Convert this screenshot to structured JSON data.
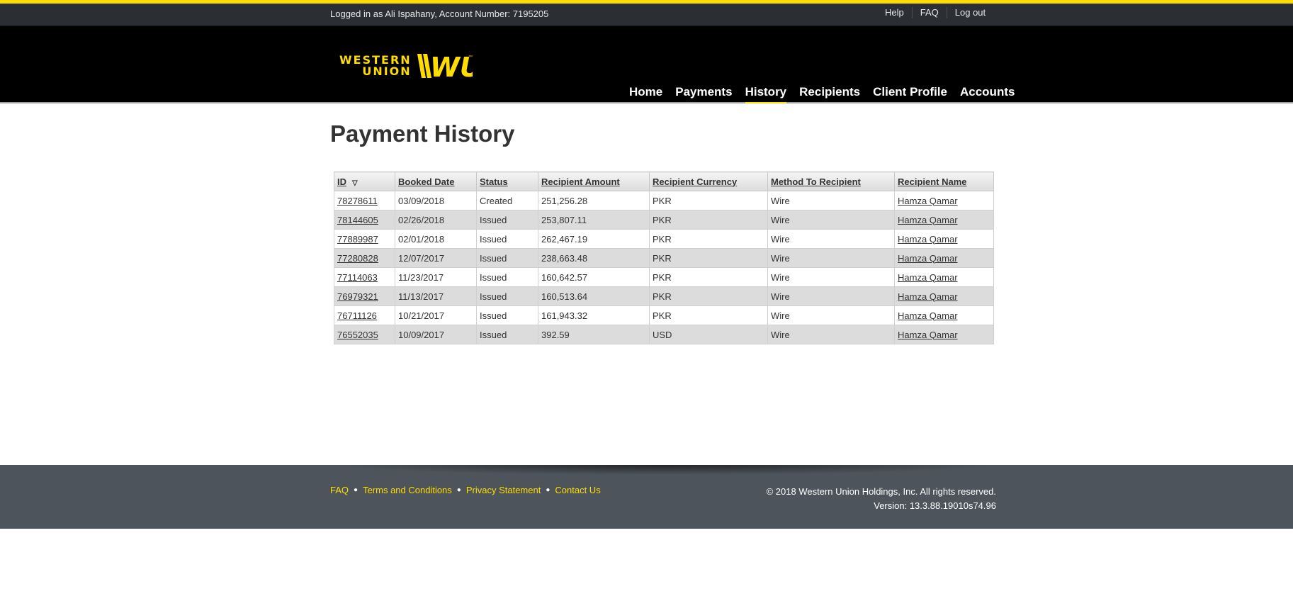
{
  "topbar": {
    "login_text": "Logged in as Ali Ispahany, Account Number: 7195205",
    "links": [
      "Help",
      "FAQ",
      "Log out"
    ]
  },
  "brand": {
    "line1": "WESTERN",
    "line2": "UNION",
    "mark": "WU",
    "colors": {
      "yellow": "#ffdd00",
      "black": "#000000"
    }
  },
  "nav": {
    "items": [
      "Home",
      "Payments",
      "History",
      "Recipients",
      "Client Profile",
      "Accounts"
    ],
    "active": "History"
  },
  "page": {
    "title": "Payment History"
  },
  "table": {
    "headers": [
      "ID",
      "Booked Date",
      "Status",
      "Recipient Amount",
      "Recipient Currency",
      "Method To Recipient",
      "Recipient Name"
    ],
    "sort_icon": "sort-down-triangle-icon",
    "rows": [
      [
        "78278611",
        "03/09/2018",
        "Created",
        "251,256.28",
        "PKR",
        "Wire",
        "Hamza Qamar"
      ],
      [
        "78144605",
        "02/26/2018",
        "Issued",
        "253,807.11",
        "PKR",
        "Wire",
        "Hamza Qamar"
      ],
      [
        "77889987",
        "02/01/2018",
        "Issued",
        "262,467.19",
        "PKR",
        "Wire",
        "Hamza Qamar"
      ],
      [
        "77280828",
        "12/07/2017",
        "Issued",
        "238,663.48",
        "PKR",
        "Wire",
        "Hamza Qamar"
      ],
      [
        "77114063",
        "11/23/2017",
        "Issued",
        "160,642.57",
        "PKR",
        "Wire",
        "Hamza Qamar"
      ],
      [
        "76979321",
        "11/13/2017",
        "Issued",
        "160,513.64",
        "PKR",
        "Wire",
        "Hamza Qamar"
      ],
      [
        "76711126",
        "10/21/2017",
        "Issued",
        "161,943.32",
        "PKR",
        "Wire",
        "Hamza Qamar"
      ],
      [
        "76552035",
        "10/09/2017",
        "Issued",
        "392.59",
        "USD",
        "Wire",
        "Hamza Qamar"
      ]
    ]
  },
  "footer": {
    "links": [
      "FAQ",
      "Terms and Conditions",
      "Privacy Statement",
      "Contact Us"
    ],
    "copyright": "© 2018 Western Union Holdings, Inc. All rights reserved.",
    "version": "Version: 13.3.88.19010s74.96"
  }
}
